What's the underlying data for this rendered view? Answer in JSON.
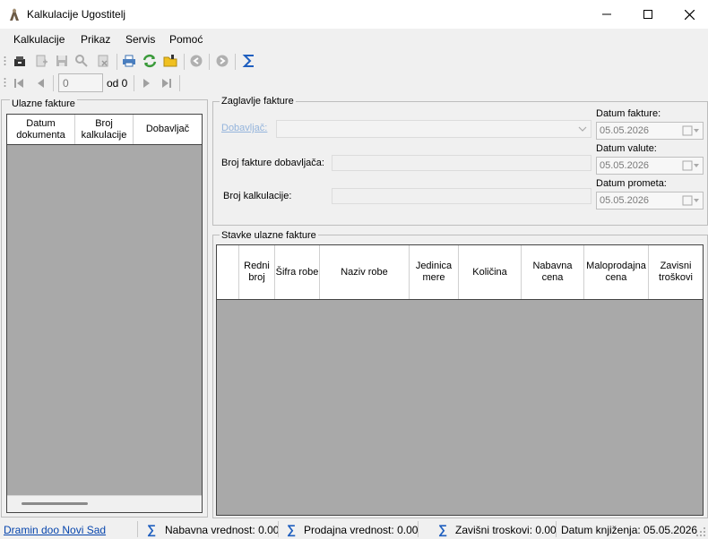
{
  "window": {
    "title": "Kalkulacije  Ugostitelj",
    "controls": [
      "minimize",
      "maximize",
      "close"
    ]
  },
  "menu": {
    "items": [
      "Kalkulacije",
      "Prikaz",
      "Servis",
      "Pomoć"
    ]
  },
  "toolbar": {
    "icons": [
      "open-icon",
      "new-icon",
      "save-icon",
      "search-icon",
      "export-icon",
      "print-icon",
      "refresh-icon",
      "folder-icon",
      "back-icon",
      "forward-icon",
      "sum-icon"
    ]
  },
  "navigator": {
    "position": "0",
    "of_label": "od 0"
  },
  "left_panel": {
    "title": "Ulazne fakture",
    "columns": [
      "Datum dokumenta",
      "Broj kalkulacije",
      "Dobavljač"
    ]
  },
  "header_group": {
    "title": "Zaglavlje fakture",
    "supplier_label": "Dobavljač:",
    "supplier_invoice_label": "Broj fakture dobavljača:",
    "calc_number_label": "Broj kalkulacije:",
    "invoice_date_label": "Datum fakture:",
    "invoice_date": "05.05.2026",
    "value_date_label": "Datum valute:",
    "value_date": "05.05.2026",
    "turnover_date_label": "Datum prometa:",
    "turnover_date": "05.05.2026"
  },
  "items_group": {
    "title": "Stavke ulazne fakture",
    "columns": [
      "Redni broj",
      "Šifra robe",
      "Naziv robe",
      "Jedinica mere",
      "Količina",
      "Nabavna cena",
      "Maloprodajna cena",
      "Zavisni troškovi"
    ]
  },
  "status": {
    "company_link": "Dramin doo Novi Sad",
    "purchase_value": "Nabavna vrednost: 0.00",
    "sales_value": "Prodajna vrednost: 0.00",
    "dependent_costs": "Zavišni troskovi: 0.00",
    "posting_date": "Datum knjiženja: 05.05.2026"
  }
}
